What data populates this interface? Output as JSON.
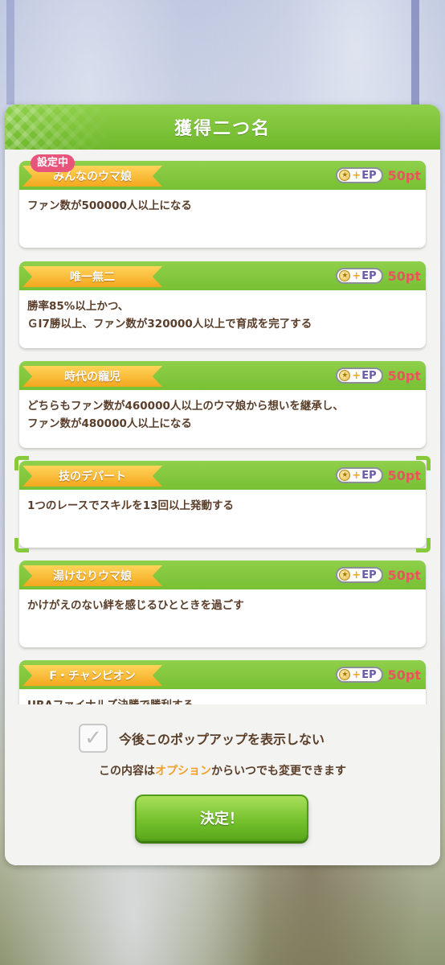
{
  "dialog": {
    "title": "獲得二つ名"
  },
  "active_tag": "設定中",
  "titles": [
    {
      "name": "みんなのウマ娘",
      "ep_label": "EP",
      "points": "50pt",
      "description": "ファン数が500000人以上になる"
    },
    {
      "name": "唯一無二",
      "ep_label": "EP",
      "points": "50pt",
      "description": "勝率85%以上かつ、\nＧⅠ7勝以上、ファン数が320000人以上で育成を完了する"
    },
    {
      "name": "時代の寵児",
      "ep_label": "EP",
      "points": "50pt",
      "description": "どちらもファン数が460000人以上のウマ娘から想いを継承し、\nファン数が480000人以上になる"
    },
    {
      "name": "技のデパート",
      "ep_label": "EP",
      "points": "50pt",
      "description": "1つのレースでスキルを13回以上発動する"
    },
    {
      "name": "湯けむりウマ娘",
      "ep_label": "EP",
      "points": "50pt",
      "description": "かけがえのない絆を感じるひとときを過ごす"
    },
    {
      "name": "F・チャンピオン",
      "ep_label": "EP",
      "points": "50pt",
      "description": "URAファイナルズ決勝で勝利する"
    }
  ],
  "footer": {
    "checkbox_label": "今後このポップアップを表示しない",
    "note_prefix": "この内容は",
    "note_accent": "オプション",
    "note_suffix": "からいつでも変更できます",
    "confirm_label": "決定！"
  },
  "colors": {
    "header_green": "#78c034",
    "ribbon_gold": "#f4a71e",
    "points_red": "#e8555e",
    "active_tag_pink": "#e8557c",
    "text_brown": "#5a3e2a"
  }
}
